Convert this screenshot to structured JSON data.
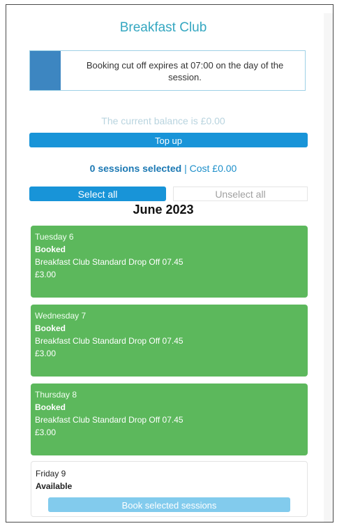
{
  "page": {
    "title": "Breakfast Club"
  },
  "notice": {
    "text": "Booking cut off expires at 07:00 on the day of the session."
  },
  "balance": {
    "text": "The current balance is £0.00"
  },
  "actions": {
    "topup_label": "Top up",
    "select_all_label": "Select all",
    "unselect_all_label": "Unselect all",
    "book_label": "Book selected sessions"
  },
  "selection": {
    "count_text": "0 sessions selected",
    "separator": " | ",
    "cost_text": "Cost £0.00"
  },
  "month": "June 2023",
  "sessions": [
    {
      "day": "Tuesday 6",
      "status": "Booked",
      "session": "Breakfast Club Standard Drop Off 07.45",
      "price": "£3.00"
    },
    {
      "day": "Wednesday 7",
      "status": "Booked",
      "session": "Breakfast Club Standard Drop Off 07.45",
      "price": "£3.00"
    },
    {
      "day": "Thursday 8",
      "status": "Booked",
      "session": "Breakfast Club Standard Drop Off 07.45",
      "price": "£3.00"
    },
    {
      "day": "Friday 9",
      "status": "Available"
    }
  ],
  "colors": {
    "booked": "#5cb85c",
    "primary": "#1894d8",
    "title": "#35a7c1"
  }
}
